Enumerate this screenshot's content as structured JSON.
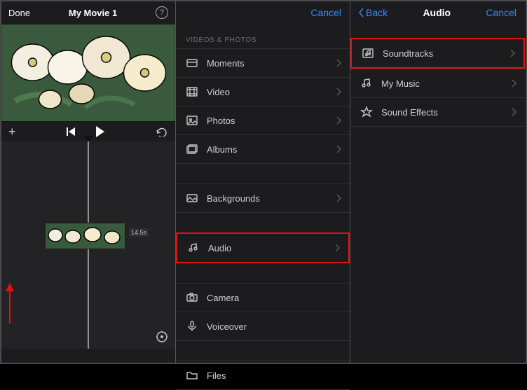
{
  "editor": {
    "done_label": "Done",
    "title": "My Movie 1",
    "help_symbol": "?",
    "add_symbol": "+",
    "clip_duration": "14.5s"
  },
  "media_panel": {
    "cancel_label": "Cancel",
    "section_label": "VIDEOS & PHOTOS",
    "rows": {
      "moments": "Moments",
      "video": "Video",
      "photos": "Photos",
      "albums": "Albums",
      "backgrounds": "Backgrounds",
      "audio": "Audio",
      "camera": "Camera",
      "voiceover": "Voiceover",
      "files": "Files"
    }
  },
  "audio_panel": {
    "back_label": "Back",
    "title": "Audio",
    "cancel_label": "Cancel",
    "rows": {
      "soundtracks": "Soundtracks",
      "my_music": "My Music",
      "sound_effects": "Sound Effects"
    }
  }
}
